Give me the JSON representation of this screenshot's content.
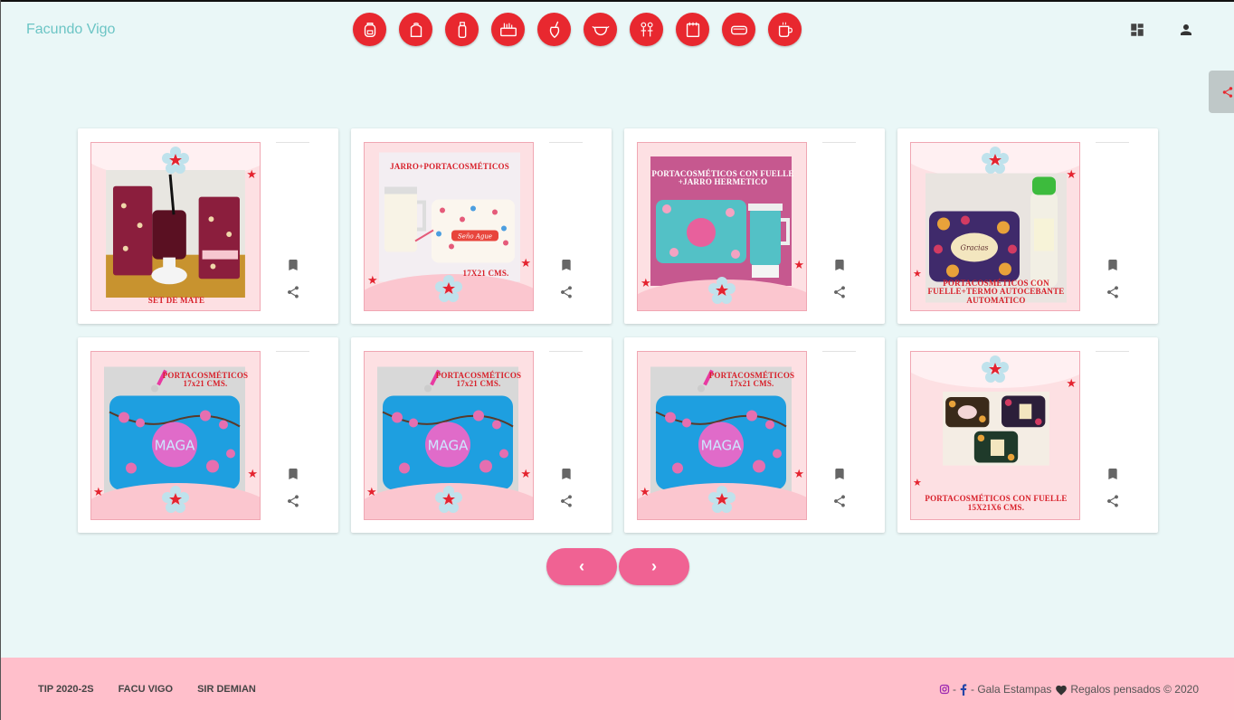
{
  "brand": "Facundo Vigo",
  "categories": [
    {
      "icon": "backpack-icon"
    },
    {
      "icon": "school-bag-icon"
    },
    {
      "icon": "thermos-icon"
    },
    {
      "icon": "pencil-case-icon"
    },
    {
      "icon": "mate-icon"
    },
    {
      "icon": "face-mask-icon"
    },
    {
      "icon": "kids-icon"
    },
    {
      "icon": "notebook-icon"
    },
    {
      "icon": "toiletry-bag-icon"
    },
    {
      "icon": "mug-icon"
    }
  ],
  "products": [
    {
      "title": "SET DE MATE",
      "scene": "mate"
    },
    {
      "title": "JARRO+PORTACOSMÉTICOS",
      "subtitle": "17X21 CMS.",
      "scene": "jarro"
    },
    {
      "title": "PORTACOSMÉTICOS CON FUELLE +JARRO HERMETICO",
      "scene": "fuelle-jarro"
    },
    {
      "title": "PORTACOSMÉTICOS CON FUELLE+TERMO AUTOCEBANTE AUTOMATICO",
      "scene": "termo"
    },
    {
      "title": "PORTACOSMÉTICOS 17x21 CMS.",
      "scene": "maga"
    },
    {
      "title": "PORTACOSMÉTICOS 17x21 CMS.",
      "scene": "maga"
    },
    {
      "title": "PORTACOSMÉTICOS 17x21 CMS.",
      "scene": "maga"
    },
    {
      "title": "PORTACOSMÉTICOS CON FUELLE 15X21X6 CMS.",
      "scene": "fuelle-set"
    }
  ],
  "pager": {
    "prev": "‹",
    "next": "›"
  },
  "footer": {
    "links": [
      "TIP 2020-2S",
      "FACU VIGO",
      "SIR DEMIAN"
    ],
    "sep1": "-",
    "sep2": "- Gala Estampas",
    "credit": "Regalos pensados © 2020"
  },
  "colors": {
    "accent": "#e8282f",
    "pink": "#f06293",
    "footer": "#ffbfcb",
    "background": "#eaf7f7",
    "brand": "#6cc5c5"
  }
}
